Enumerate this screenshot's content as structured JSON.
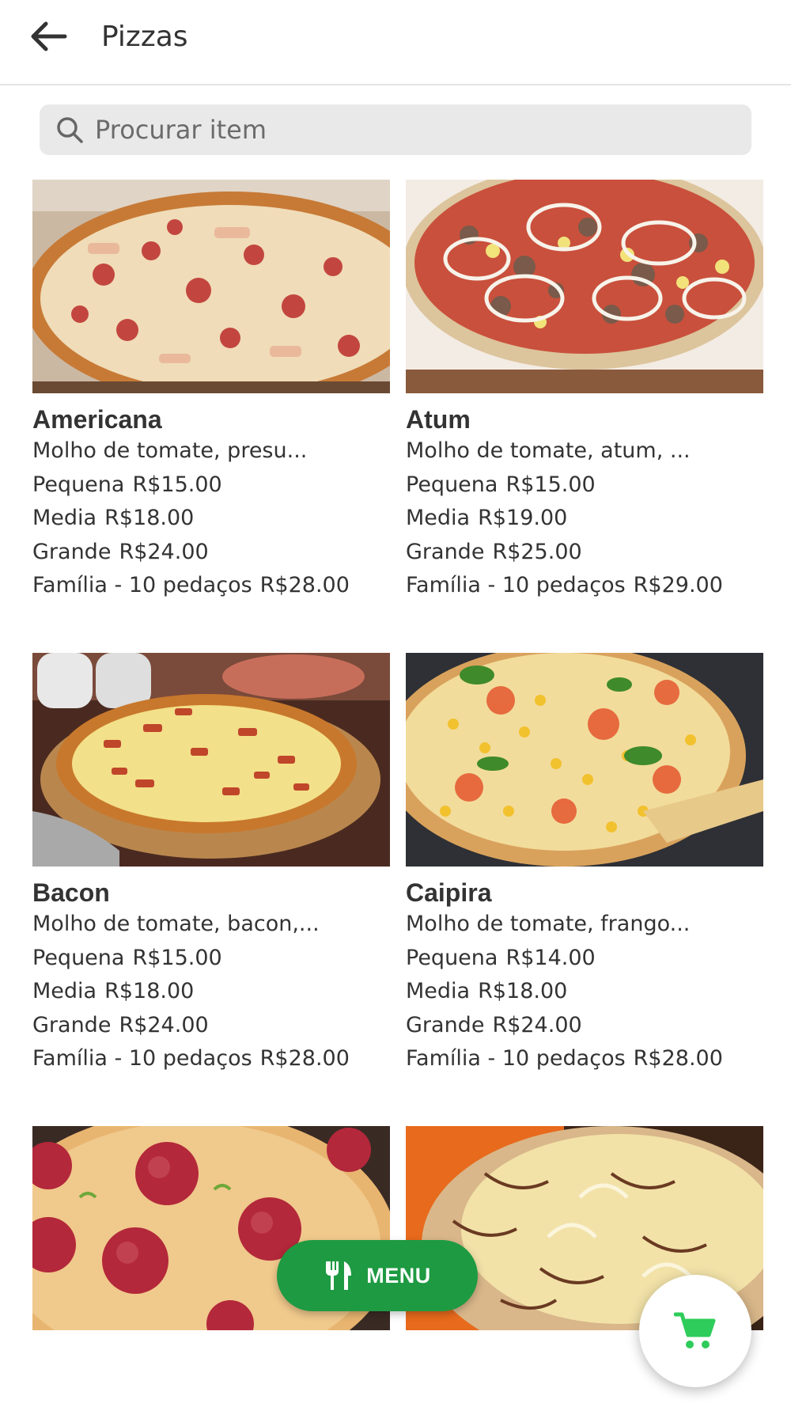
{
  "appbar": {
    "title": "Pizzas",
    "back_icon": "arrow-left-icon"
  },
  "search": {
    "placeholder": "Procurar item",
    "value": "",
    "icon": "search-icon"
  },
  "products": [
    {
      "name": "Americana",
      "description": "Molho de tomate, presu...",
      "sizes": [
        {
          "label": "Pequena",
          "price": "R$15.00"
        },
        {
          "label": "Media",
          "price": "R$18.00"
        },
        {
          "label": "Grande",
          "price": "R$24.00"
        },
        {
          "label": "Família - 10 pedaços",
          "price": "R$28.00"
        }
      ]
    },
    {
      "name": "Atum",
      "description": "Molho de tomate, atum, ...",
      "sizes": [
        {
          "label": "Pequena",
          "price": "R$15.00"
        },
        {
          "label": "Media",
          "price": "R$19.00"
        },
        {
          "label": "Grande",
          "price": "R$25.00"
        },
        {
          "label": "Família - 10 pedaços",
          "price": "R$29.00"
        }
      ]
    },
    {
      "name": "Bacon",
      "description": "Molho de tomate, bacon,...",
      "sizes": [
        {
          "label": "Pequena",
          "price": "R$15.00"
        },
        {
          "label": "Media",
          "price": "R$18.00"
        },
        {
          "label": "Grande",
          "price": "R$24.00"
        },
        {
          "label": "Família - 10 pedaços",
          "price": "R$28.00"
        }
      ]
    },
    {
      "name": "Caipira",
      "description": "Molho de tomate, frango...",
      "sizes": [
        {
          "label": "Pequena",
          "price": "R$14.00"
        },
        {
          "label": "Media",
          "price": "R$18.00"
        },
        {
          "label": "Grande",
          "price": "R$24.00"
        },
        {
          "label": "Família - 10 pedaços",
          "price": "R$28.00"
        }
      ]
    }
  ],
  "menu_button": {
    "label": "MENU",
    "icon": "fork-knife-icon"
  },
  "cart_button": {
    "icon": "shopping-cart-icon"
  },
  "colors": {
    "accent_green": "#1e9a42",
    "cart_green": "#2ecc5a",
    "search_bg": "#e9e9e9",
    "text": "#333333"
  }
}
